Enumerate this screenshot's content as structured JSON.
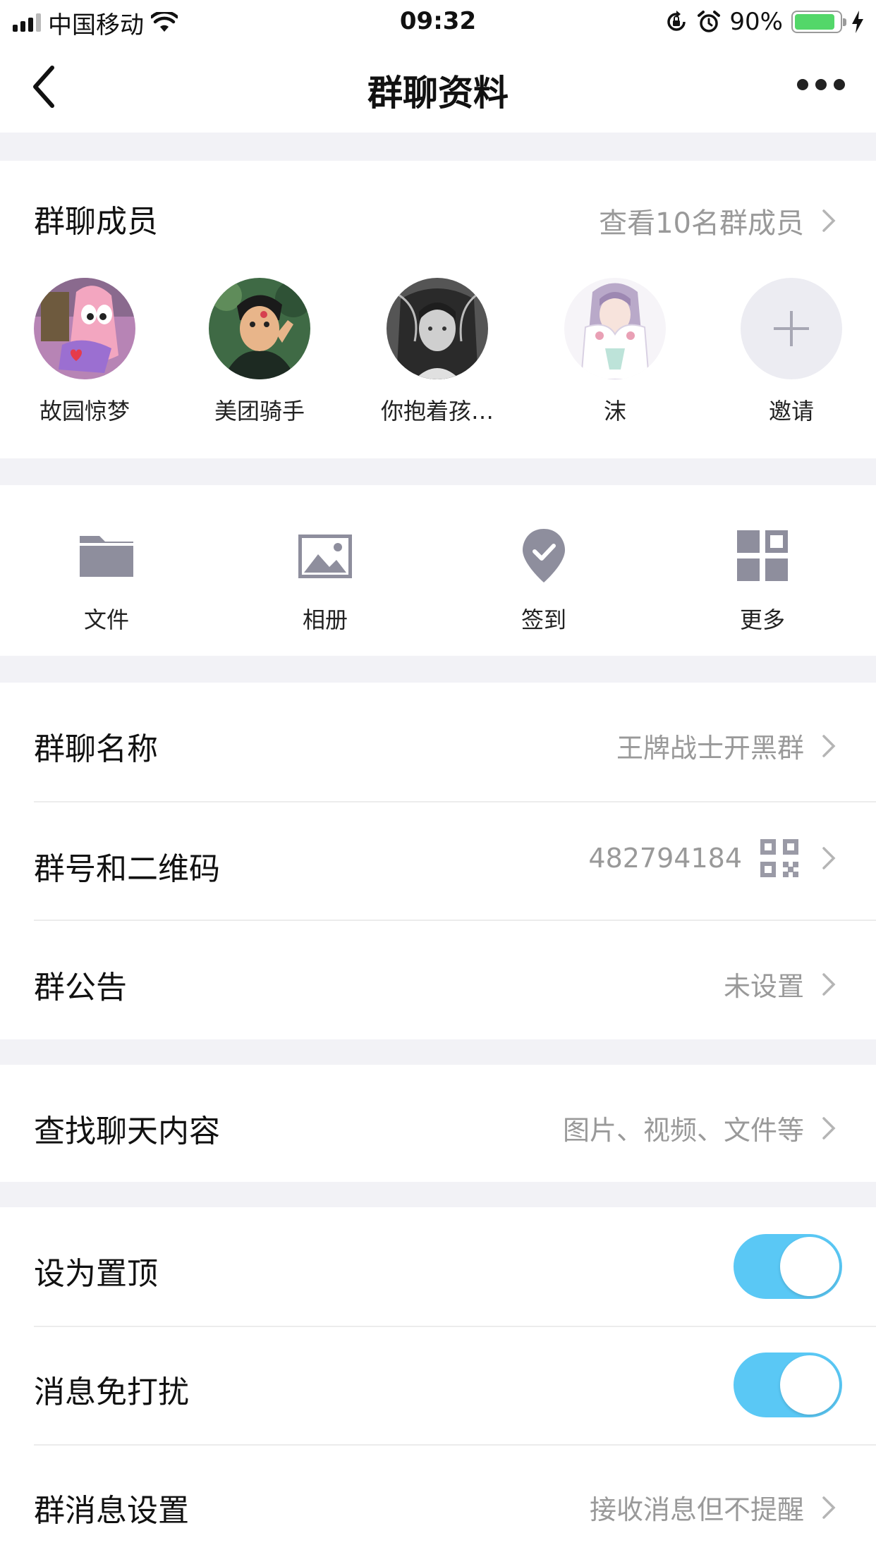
{
  "status_bar": {
    "carrier": "中国移动",
    "time": "09:32",
    "battery": "90%",
    "battery_level": 0.9,
    "icons": [
      "signal-icon",
      "wifi-icon",
      "orientation-lock-icon",
      "alarm-icon",
      "battery-icon",
      "charging-icon"
    ]
  },
  "nav": {
    "title": "群聊资料",
    "back_icon": "chevron-left-icon",
    "more_icon": "more-icon"
  },
  "members": {
    "title": "群聊成员",
    "view_all": "查看10名群成员",
    "list": [
      {
        "name": "故园惊梦"
      },
      {
        "name": "美团骑手"
      },
      {
        "name": "你抱着孩…"
      },
      {
        "name": "沫"
      }
    ],
    "invite_label": "邀请"
  },
  "tools": [
    {
      "label": "文件",
      "icon": "folder-icon"
    },
    {
      "label": "相册",
      "icon": "image-icon"
    },
    {
      "label": "签到",
      "icon": "check-in-icon"
    },
    {
      "label": "更多",
      "icon": "grid-icon"
    }
  ],
  "settings": {
    "group_name": {
      "label": "群聊名称",
      "value": "王牌战士开黑群"
    },
    "group_id": {
      "label": "群号和二维码",
      "value": "482794184"
    },
    "announcement": {
      "label": "群公告",
      "value": "未设置"
    },
    "search": {
      "label": "查找聊天内容",
      "value": "图片、视频、文件等"
    },
    "pin": {
      "label": "设为置顶",
      "on": true
    },
    "mute": {
      "label": "消息免打扰",
      "on": true
    },
    "msg_settings": {
      "label": "群消息设置",
      "value": "接收消息但不提醒"
    }
  },
  "colors": {
    "toggle_on": "#5ac8f5",
    "section_gap": "#f2f2f6",
    "icon_gray": "#8e8e9d",
    "secondary_text": "#999999"
  }
}
